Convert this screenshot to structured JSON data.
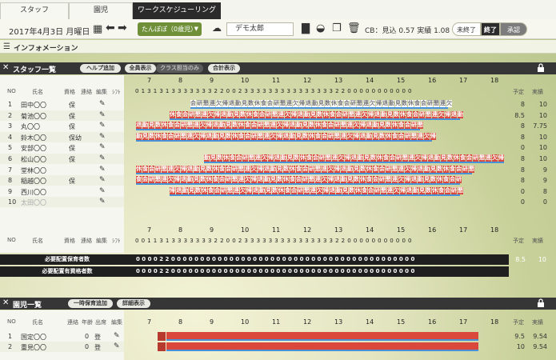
{
  "tabs": [
    "スタッフ",
    "園児",
    "ワークスケジューリング"
  ],
  "toolbar": {
    "date": "2017年4月3日 月曜日",
    "class_select": "たんぽぽ（0歳児）",
    "user": "デモ太郎",
    "cb_label": "CB：見込 0.57 実績 1.08",
    "status_unfinished": "未終了",
    "status_finished": "終了",
    "approve": "承認"
  },
  "info_title": "インフォメーション",
  "staff": {
    "title": "スタッフ一覧",
    "btn_help": "ヘルプ追加",
    "btn_all": "全員表示",
    "btn_class": "クラス担当のみ",
    "btn_total": "合計表示",
    "headers": {
      "no": "NO",
      "name": "氏名",
      "qual": "資格",
      "contact": "連絡",
      "edit": "編集",
      "shift": "ｼﾌﾄ",
      "plan": "予定",
      "actual": "実績"
    },
    "hours": [
      "7",
      "8",
      "9",
      "10",
      "11",
      "12",
      "13",
      "14",
      "15",
      "16",
      "17",
      "18"
    ],
    "top_ticks": "0 1 3 1 3 1 3 3 3 3 3 3 3 2 2 0 0 2 3 3 3 3 3 3 3 3 3 3 3 3 3 3 3 2 2 0 0 0 0 0 0 0 0 0 0 0",
    "bottom_ticks": "0 0 1 1 3 1 3 3 3 3 3 3 3 2 2 0 0 2 3 3 3 3 3 3 3 3 3 3 3 3 3 3 3 2 2 0 0 0 0 0 0 0 0 0 0 0",
    "rows": [
      {
        "no": "1",
        "name": "田中〇〇",
        "qual": "保",
        "plan": "8",
        "actual": "10"
      },
      {
        "no": "2",
        "name": "菊池〇〇",
        "qual": "保",
        "plan": "8.5",
        "actual": "10"
      },
      {
        "no": "3",
        "name": "丸〇〇",
        "qual": "保",
        "plan": "8",
        "actual": "7.75"
      },
      {
        "no": "4",
        "name": "鈴木〇〇",
        "qual": "保幼",
        "plan": "8",
        "actual": "10"
      },
      {
        "no": "5",
        "name": "安部〇〇",
        "qual": "保",
        "plan": "0",
        "actual": "10"
      },
      {
        "no": "6",
        "name": "松山〇〇",
        "qual": "保",
        "plan": "8",
        "actual": "10"
      },
      {
        "no": "7",
        "name": "堂林〇〇",
        "qual": "",
        "plan": "8",
        "actual": "9"
      },
      {
        "no": "8",
        "name": "稲越〇〇",
        "qual": "保",
        "plan": "8",
        "actual": "9"
      },
      {
        "no": "9",
        "name": "西川〇〇",
        "qual": "",
        "plan": "0",
        "actual": "8"
      },
      {
        "no": "10",
        "name": "太田〇〇",
        "qual": "",
        "plan": "0",
        "actual": "0"
      }
    ],
    "need_label1": "必要配置保育者数",
    "need_label2": "必要配置有資格者数",
    "need_ticks": "0 0 0 0 2 2 0 0 0 0 0 0 0 0 0 0 0 0 0 0 0 0 0 0 0 0 0 0 0 0 0 0 0 0 0 0 0 0 0 0 0 0 0 0 0 0 0 0",
    "totals": {
      "plan": "8.5",
      "actual": "10"
    },
    "shift_word": "見",
    "cell_words": [
      "勤",
      "見",
      "数",
      "休",
      "食",
      "会",
      "研",
      "懇",
      "連",
      "欠",
      "帰",
      "退"
    ]
  },
  "children": {
    "title": "園児一覧",
    "btn_temp": "一時保育追加",
    "btn_detail": "詳細表示",
    "headers": {
      "no": "NO",
      "name": "氏名",
      "contact": "連絡",
      "age": "年齢",
      "attend": "出席",
      "edit": "編集",
      "plan": "予定",
      "actual": "実績"
    },
    "rows": [
      {
        "no": "1",
        "name": "国定〇〇",
        "age": "0",
        "attend": "登",
        "plan": "9.5",
        "actual": "9.54"
      },
      {
        "no": "2",
        "name": "重見〇〇",
        "age": "0",
        "attend": "登",
        "plan": "10",
        "actual": "9.54"
      }
    ]
  },
  "colors": {
    "accent": "#6f8f38",
    "red": "#d9483b",
    "blue": "#4791d8",
    "dark": "#363636"
  }
}
